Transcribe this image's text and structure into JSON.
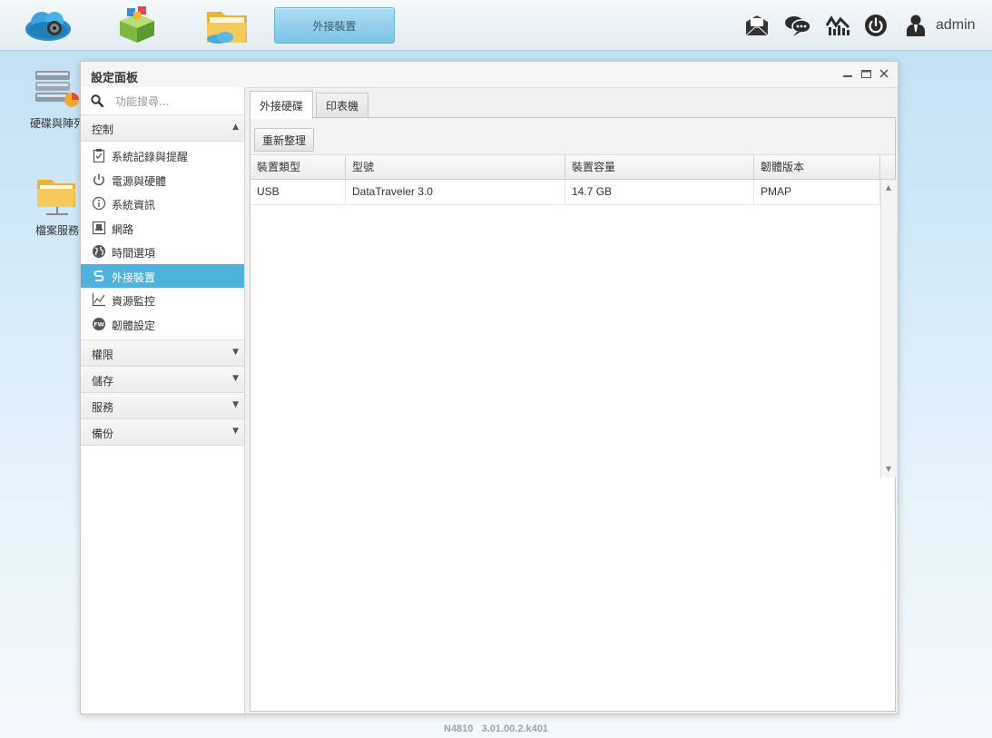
{
  "taskbar": {
    "active_app": "外接裝置",
    "apps": [
      "cloud-app-icon",
      "app-center-icon",
      "file-manager-icon"
    ],
    "user": "admin"
  },
  "desktop": {
    "icons": [
      {
        "label": "硬碟與陣列",
        "icon": "disk-array-icon"
      },
      {
        "label": "檔案服務",
        "icon": "file-service-icon"
      }
    ]
  },
  "window": {
    "title": "設定面板",
    "search_placeholder": "功能搜尋...",
    "categories": {
      "control": {
        "label": "控制",
        "expanded": true
      },
      "permission": {
        "label": "權限"
      },
      "storage": {
        "label": "儲存"
      },
      "service": {
        "label": "服務"
      },
      "backup": {
        "label": "備份"
      }
    },
    "control_items": [
      {
        "label": "系統記錄與提醒",
        "icon": "log-clipboard-icon"
      },
      {
        "label": "電源與硬體",
        "icon": "power-icon"
      },
      {
        "label": "系統資訊",
        "icon": "info-icon"
      },
      {
        "label": "網路",
        "icon": "network-icon"
      },
      {
        "label": "時間選項",
        "icon": "globe-icon"
      },
      {
        "label": "外接裝置",
        "icon": "usb-icon",
        "active": true
      },
      {
        "label": "資源監控",
        "icon": "chart-icon"
      },
      {
        "label": "韌體設定",
        "icon": "firmware-icon"
      }
    ]
  },
  "content": {
    "tabs": [
      "外接硬碟",
      "印表機"
    ],
    "refresh_label": "重新整理",
    "columns": [
      "裝置類型",
      "型號",
      "裝置容量",
      "韌體版本"
    ],
    "rows": [
      {
        "type": "USB",
        "model": "DataTraveler 3.0",
        "capacity": "14.7 GB",
        "firmware": "PMAP"
      }
    ]
  },
  "footer": {
    "version": "N4810   3.01.00.2.k401"
  },
  "colors": {
    "accent": "#4db2dc",
    "active_tab": "#7cc4e6"
  }
}
